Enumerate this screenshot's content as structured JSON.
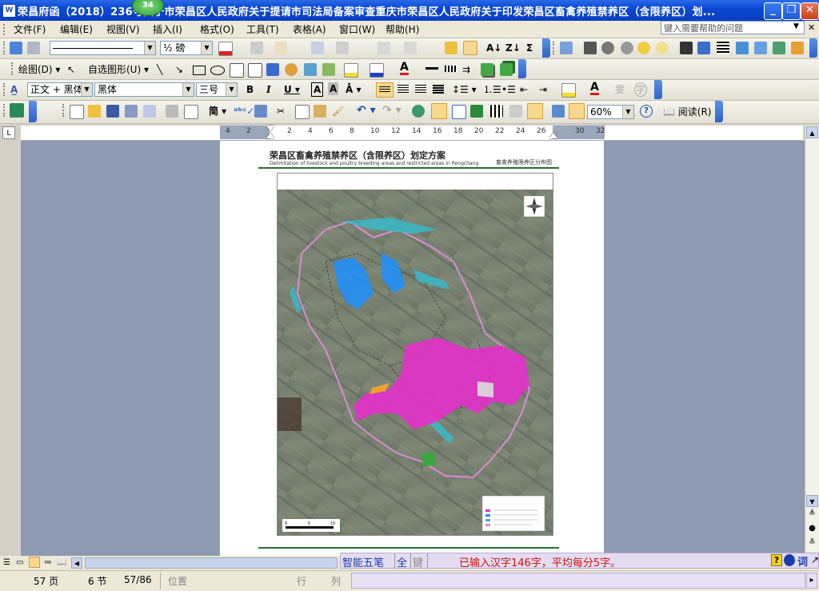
{
  "window": {
    "title": "荣昌府函（2018）236号关于市荣昌区人民政府关于提请市司法局备案审查重庆市荣昌区人民政府关于印发荣昌区畜禽养殖禁养区（含限养区）划...",
    "badge": "34",
    "app_icon": "W"
  },
  "menu": {
    "items": [
      "文件(F)",
      "编辑(E)",
      "视图(V)",
      "插入(I)",
      "格式(O)",
      "工具(T)",
      "表格(A)",
      "窗口(W)",
      "帮助(H)"
    ],
    "help_placeholder": "键入需要帮助的问题"
  },
  "toolbar_format": {
    "line_weight": "½ 磅",
    "style": "正文 + 黑体",
    "font": "黑体",
    "size": "三号"
  },
  "toolbar_draw": {
    "draw_label": "绘图(D)",
    "autoshape_label": "自选图形(U)"
  },
  "toolbar_standard": {
    "zoom": "60%",
    "read_label": "阅读(R)"
  },
  "ruler": {
    "ticks": [
      "4",
      "2",
      "2",
      "4",
      "6",
      "8",
      "10",
      "12",
      "14",
      "16",
      "18",
      "20",
      "22",
      "24",
      "26",
      "30",
      "32"
    ]
  },
  "document": {
    "heading": "荣昌区畜禽养殖禁养区（含限养区）划定方案",
    "subheading": "Delimitation of livestock and poultry breeding areas and restricted areas in Rongchang",
    "map_title": "畜禽养殖限养区分布图",
    "scale_labels": [
      "0",
      "5",
      "10"
    ]
  },
  "ime": {
    "mode": "智能五笔",
    "full": "全",
    "key": "键",
    "message": "已输入汉字146字，平均每分5字。",
    "ci": "词"
  },
  "status": {
    "page": "57 页",
    "section": "6 节",
    "pages": "57/86",
    "position": "位置",
    "line": "行",
    "col": "列"
  },
  "colors": {
    "titlebar": "#0a48d4",
    "restricted_zone": "#e232c8",
    "water_zone": "#1e90ff",
    "boundary": "#d98cd0"
  }
}
